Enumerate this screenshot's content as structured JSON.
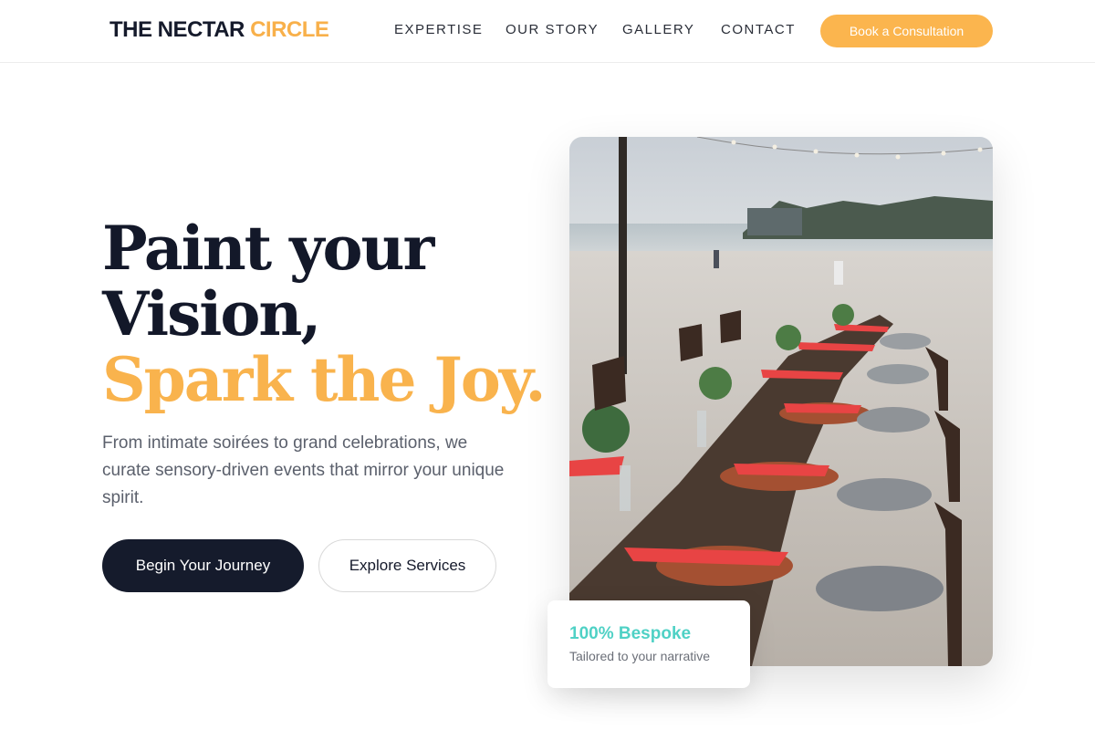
{
  "brand": {
    "name_main": "THE NECTAR ",
    "name_accent": "CIRCLE"
  },
  "nav": {
    "items": [
      "EXPERTISE",
      "OUR STORY",
      "GALLERY",
      "CONTACT"
    ],
    "cta_label": "Book a Consultation"
  },
  "hero": {
    "headline_line1": "Paint your",
    "headline_line2": "Vision,",
    "headline_line3": "Spark the Joy.",
    "subtext": "From intimate soirées to grand celebrations, we curate sensory-driven events that mirror your unique spirit.",
    "primary_button": "Begin Your Journey",
    "secondary_button": "Explore Services"
  },
  "badge": {
    "title": "100% Bespoke",
    "subtitle": "Tailored to your narrative"
  },
  "colors": {
    "accent": "#f9b34d",
    "dark": "#151b2c",
    "teal": "#4fd1c5"
  }
}
